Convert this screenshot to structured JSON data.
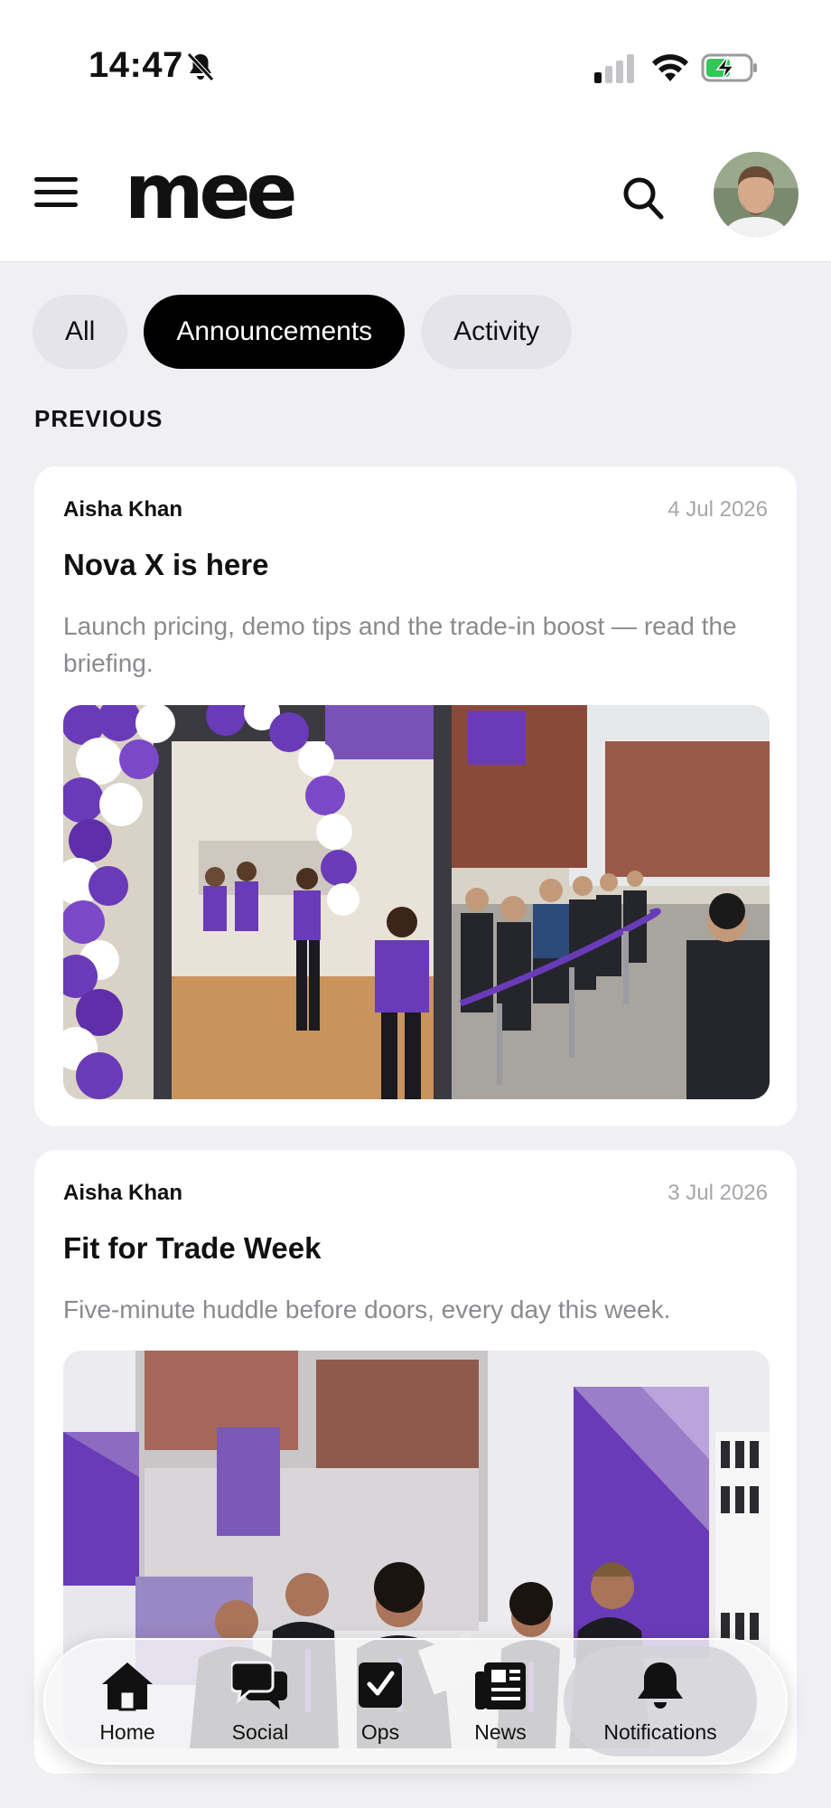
{
  "status_bar": {
    "time": "14:47",
    "icons": [
      "bell-off-icon",
      "signal-icon",
      "wifi-icon",
      "battery-charging-icon"
    ]
  },
  "header": {
    "logo": "mee",
    "icons": [
      "menu-icon",
      "search-icon",
      "avatar"
    ]
  },
  "filters": {
    "tabs": [
      {
        "label": "All",
        "active": false
      },
      {
        "label": "Announcements",
        "active": true
      },
      {
        "label": "Activity",
        "active": false
      }
    ]
  },
  "feed": {
    "section_label": "PREVIOUS",
    "posts": [
      {
        "author": "Aisha Khan",
        "date": "4 Jul 2026",
        "title": "Nova X is here",
        "summary": "Launch pricing, demo tips and the trade-in boost — read the briefing."
      },
      {
        "author": "Aisha Khan",
        "date": "3 Jul 2026",
        "title": "Fit for Trade Week",
        "summary": "Five-minute huddle before doors, every day this week."
      }
    ]
  },
  "bottom_nav": {
    "items": [
      {
        "label": "Home",
        "icon": "home-icon",
        "active": false
      },
      {
        "label": "Social",
        "icon": "chat-bubbles-icon",
        "active": false
      },
      {
        "label": "Ops",
        "icon": "checkbox-icon",
        "active": false
      },
      {
        "label": "News",
        "icon": "newspaper-icon",
        "active": false
      },
      {
        "label": "Notifications",
        "icon": "bell-icon",
        "active": true
      }
    ]
  },
  "colors": {
    "brand_purple": "#6a3bb8",
    "active_tab_bg": "#000000",
    "background": "#efeff4"
  }
}
